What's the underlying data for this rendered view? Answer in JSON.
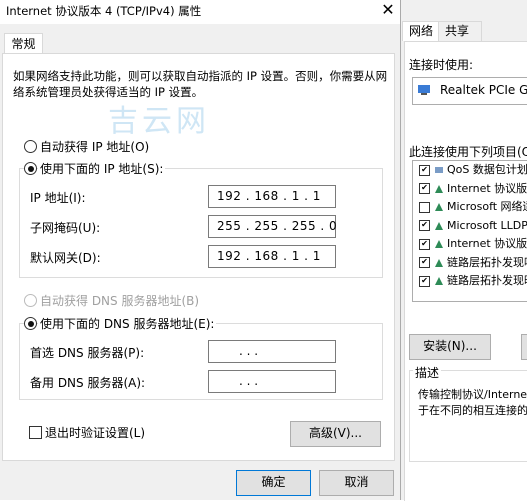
{
  "dialog": {
    "title": "Internet 协议版本 4 (TCP/IPv4) 属性",
    "close_glyph": "✕",
    "tab": "常规",
    "description_line1": "如果网络支持此功能，则可以获取自动指派的 IP 设置。否则，你需要从网",
    "description_line2": "络系统管理员处获得适当的 IP 设置。",
    "watermark": "吉云网",
    "ip_auto_label": "自动获得 IP 地址(O)",
    "ip_manual_label": "使用下面的 IP 地址(S):",
    "ip_address_label": "IP 地址(I):",
    "subnet_label": "子网掩码(U):",
    "gateway_label": "默认网关(D):",
    "ip_address_value": "192 .  168 .   1   .   1",
    "subnet_value": "255 . 255 . 255 .  0",
    "gateway_value": "192 .  168 .   1   .   1",
    "dns_auto_label": "自动获得 DNS 服务器地址(B)",
    "dns_manual_label": "使用下面的 DNS 服务器地址(E):",
    "dns_pref_label": "首选 DNS 服务器(P):",
    "dns_alt_label": "备用 DNS 服务器(A):",
    "dns_pref_value": ".      .      .",
    "dns_alt_value": ".      .      .",
    "validate_label": "退出时验证设置(L)",
    "advanced_button": "高级(V)...",
    "ok_button": "确定",
    "cancel_button": "取消"
  },
  "background_dialog": {
    "tab_network": "网络",
    "tab_share": "共享",
    "connect_using_label": "连接时使用:",
    "adapter_name": "Realtek PCIe GbE",
    "items_label": "此连接使用下列项目(O):",
    "items": [
      {
        "label": "QoS 数据包计划程",
        "checked": "✔"
      },
      {
        "label": "Internet 协议版本",
        "checked": "✔"
      },
      {
        "label": "Microsoft 网络适",
        "checked": ""
      },
      {
        "label": "Microsoft LLDP 协",
        "checked": "✔"
      },
      {
        "label": "Internet 协议版本",
        "checked": "✔"
      },
      {
        "label": "链路层拓扑发现响",
        "checked": "✔"
      },
      {
        "label": "链路层拓扑发现映",
        "checked": "✔"
      }
    ],
    "install_button": "安装(N)...",
    "description_label": "描述",
    "description_line1": "传输控制协议/Internet",
    "description_line2": "于在不同的相互连接的"
  },
  "colors": {
    "accent": "#0078d7",
    "watermark": "#cfe6f5"
  }
}
